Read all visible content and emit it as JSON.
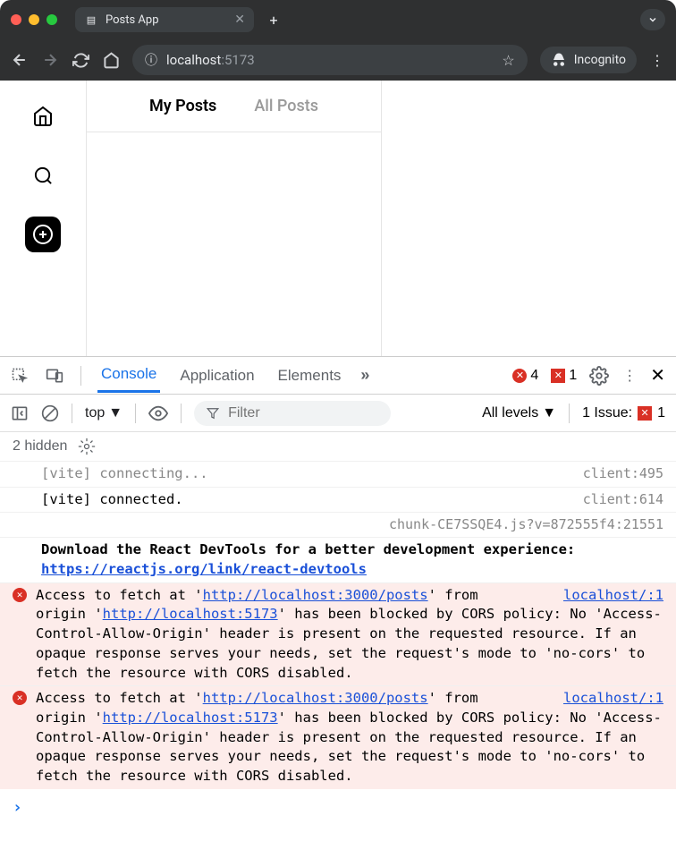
{
  "browser": {
    "tabTitle": "Posts App",
    "url": {
      "host": "localhost",
      "port": ":5173"
    },
    "incognito": "Incognito"
  },
  "app": {
    "tabs": {
      "myPosts": "My Posts",
      "allPosts": "All Posts"
    }
  },
  "devtools": {
    "tabs": {
      "console": "Console",
      "application": "Application",
      "elements": "Elements"
    },
    "errorCount": "4",
    "issueBadge": "1",
    "filter": {
      "context": "top",
      "placeholder": "Filter",
      "levels": "All levels",
      "issuesLabel": "1 Issue:",
      "issuesCount": "1",
      "hidden": "2 hidden"
    },
    "logs": {
      "l1": {
        "msg": "[vite] connecting...",
        "src": "client:495"
      },
      "l2": {
        "msg": "[vite] connected.",
        "src": "client:614"
      },
      "l3": {
        "src": "chunk-CE7SSQE4.js?v=872555f4:21551"
      },
      "l4": {
        "intro": "Download the React DevTools for a better development experience: ",
        "link": "https://reactjs.org/link/react-devtools"
      },
      "err": {
        "p1": "Access to fetch at '",
        "u1": "http://localhost:3000/posts",
        "p2": "' from ",
        "u2": "localhost/:1",
        "p3": "origin '",
        "u3": "http://localhost:5173",
        "p4": "' has been blocked by CORS policy: No 'Access-Control-Allow-Origin' header is present on the requested resource. If an opaque response serves your needs, set the request's mode to 'no-cors' to fetch the resource with CORS disabled."
      }
    }
  }
}
